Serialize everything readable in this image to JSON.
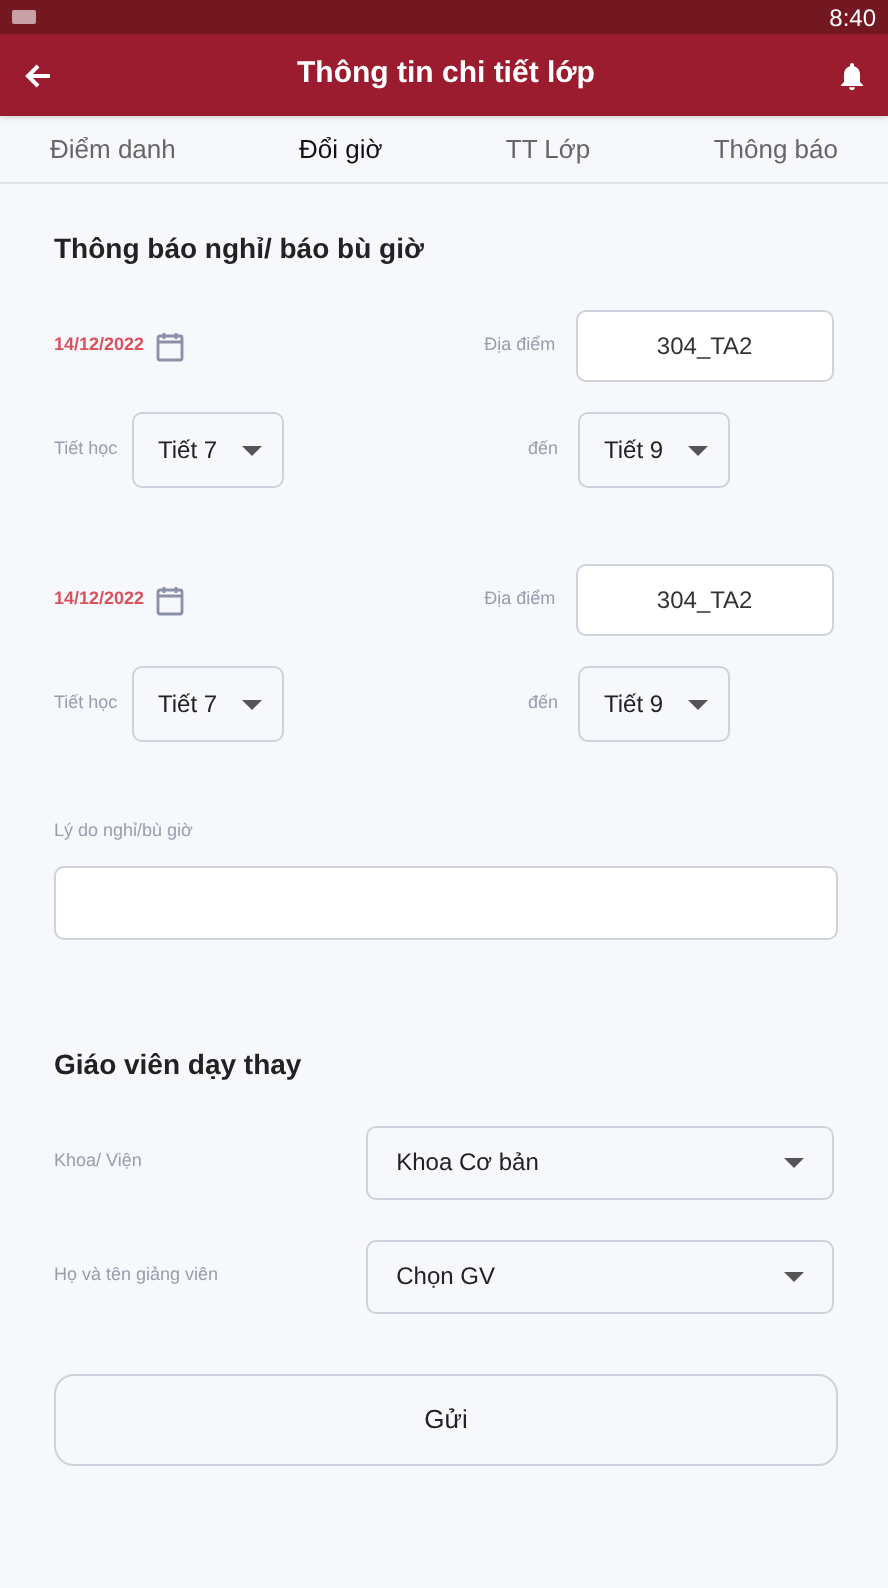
{
  "status_bar": {
    "time": "8:40"
  },
  "app_bar": {
    "title": "Thông tin chi tiết lớp"
  },
  "tabs": [
    {
      "label": "Điểm danh",
      "selected": false
    },
    {
      "label": "Đổi giờ",
      "selected": true
    },
    {
      "label": "TT Lớp",
      "selected": false
    },
    {
      "label": "Thông báo",
      "selected": false
    }
  ],
  "notice_section": {
    "title": "Thông báo nghỉ/ báo bù giờ",
    "sessions": [
      {
        "date": "14/12/2022",
        "location_label": "Địa điểm",
        "location": "304_TA2",
        "period_label": "Tiết học",
        "from": "Tiết 7",
        "to_label": "đến",
        "to": "Tiết 9"
      },
      {
        "date": "14/12/2022",
        "location_label": "Địa điểm",
        "location": "304_TA2",
        "period_label": "Tiết học",
        "from": "Tiết 7",
        "to_label": "đến",
        "to": "Tiết 9"
      }
    ],
    "reason_label": "Lý do nghỉ/bù giờ"
  },
  "substitute_section": {
    "title": "Giáo viên dạy thay",
    "fields": [
      {
        "label": "Khoa/ Viện",
        "value": "Khoa Cơ bản"
      },
      {
        "label": "Họ và tên giảng viên",
        "value": "Chọn GV"
      }
    ]
  },
  "submit_button": "Gửi"
}
